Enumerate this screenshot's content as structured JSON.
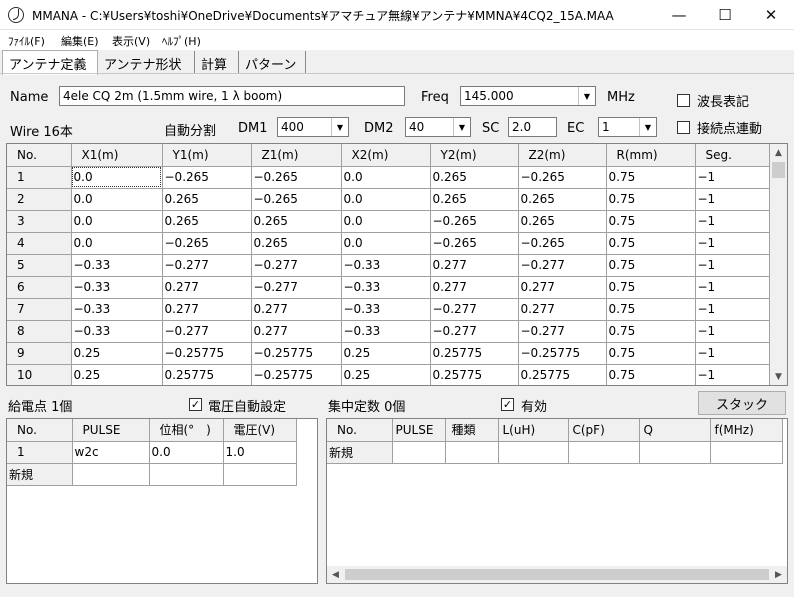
{
  "window": {
    "title": "MMANA - C:¥Users¥toshi¥OneDrive¥Documents¥アマチュア無線¥アンテナ¥MMNA¥4CQ2_15A.MAA",
    "minimize": "—",
    "maximize": "☐",
    "close": "✕"
  },
  "menu": [
    "ﾌｧｲﾙ(F)",
    "編集(E)",
    "表示(V)",
    "ﾍﾙﾌﾟ(H)"
  ],
  "tabs": [
    "アンテナ定義",
    "アンテナ形状",
    "計算",
    "パターン"
  ],
  "form": {
    "name_label": "Name",
    "name_value": "4ele CQ 2m (1.5mm wire, 1 λ  boom)",
    "freq_label": "Freq",
    "freq_value": "145.000",
    "freq_unit": "MHz",
    "wavelength_label": "波長表記",
    "wavelength_check": "",
    "junction_label": "接続点連動",
    "junction_check": "",
    "wire_label": "Wire 16本",
    "autoseg_label": "自動分割",
    "dm1_label": "DM1",
    "dm1_value": "400",
    "dm2_label": "DM2",
    "dm2_value": "40",
    "sc_label": "SC",
    "sc_value": "2.0",
    "ec_label": "EC",
    "ec_value": "1"
  },
  "wire_table": {
    "columns": [
      "No.",
      "X1(m)",
      "Y1(m)",
      "Z1(m)",
      "X2(m)",
      "Y2(m)",
      "Z2(m)",
      "R(mm)",
      "Seg."
    ],
    "rows": [
      [
        "1",
        "0.0",
        "−0.265",
        "−0.265",
        "0.0",
        "0.265",
        "−0.265",
        "0.75",
        "−1"
      ],
      [
        "2",
        "0.0",
        "0.265",
        "−0.265",
        "0.0",
        "0.265",
        "0.265",
        "0.75",
        "−1"
      ],
      [
        "3",
        "0.0",
        "0.265",
        "0.265",
        "0.0",
        "−0.265",
        "0.265",
        "0.75",
        "−1"
      ],
      [
        "4",
        "0.0",
        "−0.265",
        "0.265",
        "0.0",
        "−0.265",
        "−0.265",
        "0.75",
        "−1"
      ],
      [
        "5",
        "−0.33",
        "−0.277",
        "−0.277",
        "−0.33",
        "0.277",
        "−0.277",
        "0.75",
        "−1"
      ],
      [
        "6",
        "−0.33",
        "0.277",
        "−0.277",
        "−0.33",
        "0.277",
        "0.277",
        "0.75",
        "−1"
      ],
      [
        "7",
        "−0.33",
        "0.277",
        "0.277",
        "−0.33",
        "−0.277",
        "0.277",
        "0.75",
        "−1"
      ],
      [
        "8",
        "−0.33",
        "−0.277",
        "0.277",
        "−0.33",
        "−0.277",
        "−0.277",
        "0.75",
        "−1"
      ],
      [
        "9",
        "0.25",
        "−0.25775",
        "−0.25775",
        "0.25",
        "0.25775",
        "−0.25775",
        "0.75",
        "−1"
      ],
      [
        "10",
        "0.25",
        "0.25775",
        "−0.25775",
        "0.25",
        "0.25775",
        "0.25775",
        "0.75",
        "−1"
      ]
    ]
  },
  "feed": {
    "label": "給電点 1個",
    "auto_voltage_label": "電圧自動設定",
    "auto_voltage_check": "✓",
    "columns": [
      "No.",
      "PULSE",
      "位相(°　)",
      "電圧(V)"
    ],
    "rows": [
      [
        "1",
        "w2c",
        "0.0",
        "1.0"
      ],
      [
        "新規",
        "",
        "",
        ""
      ]
    ]
  },
  "loads": {
    "label": "集中定数 0個",
    "enabled_label": "有効",
    "enabled_check": "✓",
    "stack_button": "スタック",
    "columns": [
      "No.",
      "PULSE",
      "種類",
      "L(uH)",
      "C(pF)",
      "Q",
      "f(MHz)"
    ],
    "rows": [
      [
        "新規",
        "",
        "",
        "",
        "",
        "",
        ""
      ]
    ]
  }
}
